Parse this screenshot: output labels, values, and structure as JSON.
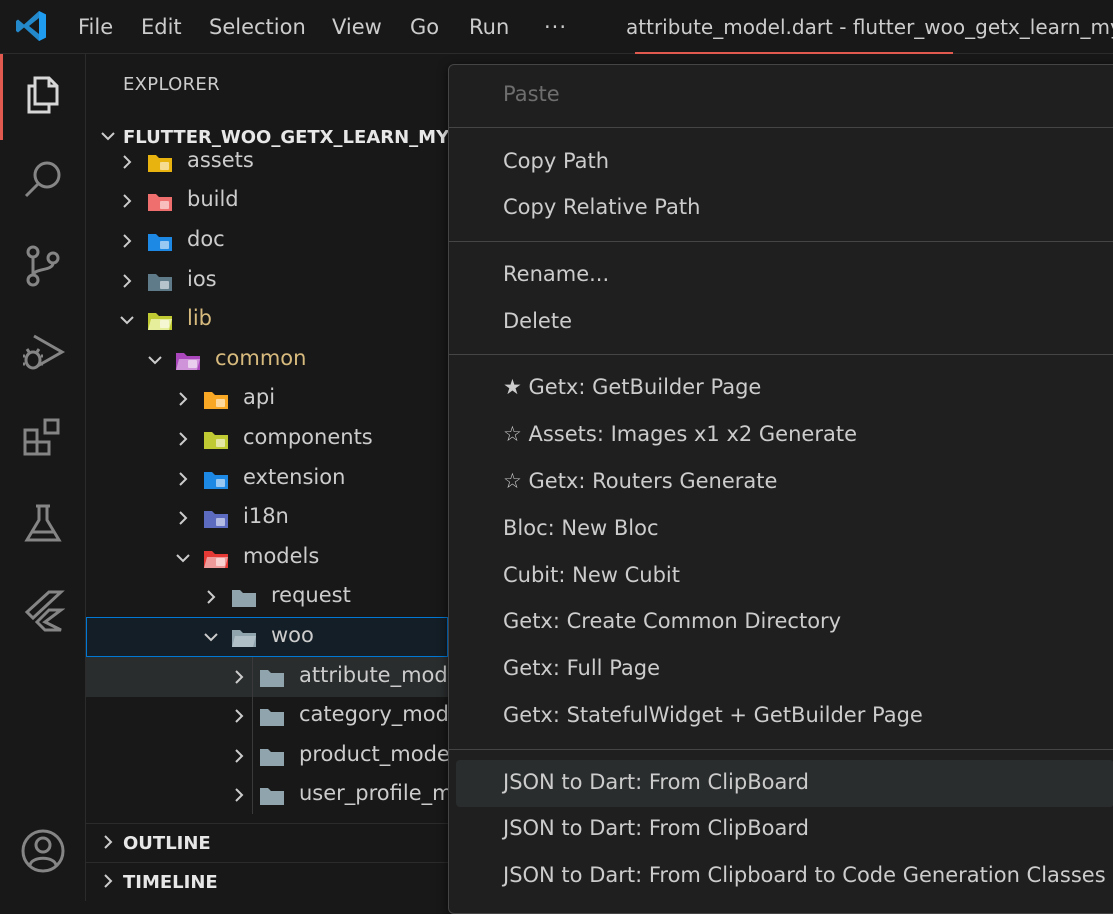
{
  "titlebar": {
    "menus": [
      "File",
      "Edit",
      "Selection",
      "View",
      "Go",
      "Run",
      "···"
    ],
    "title": "attribute_model.dart - flutter_woo_getx_learn_my -"
  },
  "explorer": {
    "title": "EXPLORER",
    "project": "FLUTTER_WOO_GETX_LEARN_MY",
    "tree": [
      {
        "label": "assets",
        "expanded": false,
        "icon": "folder-assets-icon"
      },
      {
        "label": "build",
        "expanded": false,
        "icon": "folder-build-icon"
      },
      {
        "label": "doc",
        "expanded": false,
        "icon": "folder-doc-icon"
      },
      {
        "label": "ios",
        "expanded": false,
        "icon": "folder-ios-icon"
      },
      {
        "label": "lib",
        "expanded": true,
        "icon": "folder-lib-icon"
      },
      {
        "label": "common",
        "expanded": true,
        "icon": "folder-common-icon"
      },
      {
        "label": "api",
        "expanded": false,
        "icon": "folder-api-icon"
      },
      {
        "label": "components",
        "expanded": false,
        "icon": "folder-components-icon"
      },
      {
        "label": "extension",
        "expanded": false,
        "icon": "folder-extension-icon"
      },
      {
        "label": "i18n",
        "expanded": false,
        "icon": "folder-i18n-icon"
      },
      {
        "label": "models",
        "expanded": true,
        "icon": "folder-models-icon"
      },
      {
        "label": "request",
        "expanded": false,
        "icon": "folder-icon"
      },
      {
        "label": "woo",
        "expanded": true,
        "icon": "folder-open-icon"
      },
      {
        "label": "attribute_model",
        "expanded": false,
        "icon": "folder-icon"
      },
      {
        "label": "category_model",
        "expanded": false,
        "icon": "folder-icon"
      },
      {
        "label": "product_model",
        "expanded": false,
        "icon": "folder-icon"
      },
      {
        "label": "user_profile_model",
        "expanded": false,
        "icon": "folder-icon"
      }
    ],
    "outline": "OUTLINE",
    "timeline": "TIMELINE"
  },
  "context_menu": {
    "paste": "Paste",
    "copy_path": "Copy Path",
    "copy_relative_path": "Copy Relative Path",
    "rename": "Rename...",
    "delete": "Delete",
    "getx_getbuilder": "★ Getx: GetBuilder Page",
    "assets_images": "☆ Assets: Images x1 x2 Generate",
    "getx_routers": "☆ Getx: Routers Generate",
    "bloc_new": "Bloc: New Bloc",
    "cubit_new": "Cubit: New Cubit",
    "getx_common_dir": "Getx: Create Common Directory",
    "getx_full_page": "Getx: Full Page",
    "getx_stateful": "Getx: StatefulWidget + GetBuilder Page",
    "json_clipboard_1": "JSON to Dart: From ClipBoard",
    "json_clipboard_2": "JSON to Dart: From ClipBoard",
    "json_codegen": "JSON to Dart: From Clipboard to Code Generation Classes"
  },
  "colors": {
    "accent": "#e05a4f",
    "selection_border": "#0078d4",
    "lib_folder_text": "#d7ba7d"
  }
}
